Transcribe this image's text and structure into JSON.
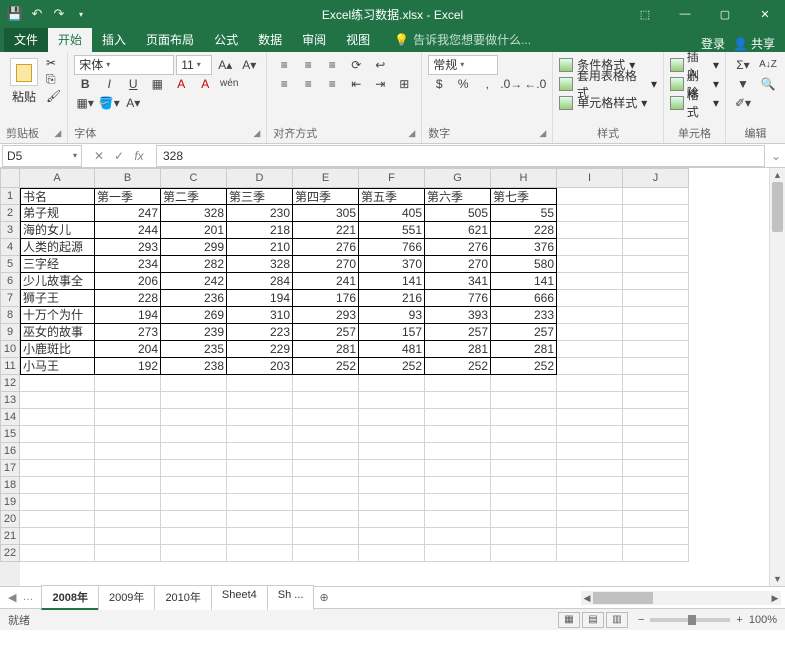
{
  "window": {
    "title": "Excel练习数据.xlsx - Excel"
  },
  "tabs": {
    "file": "文件",
    "home": "开始",
    "insert": "插入",
    "pagelayout": "页面布局",
    "formulas": "公式",
    "data": "数据",
    "review": "审阅",
    "view": "视图",
    "tellme": "告诉我您想要做什么...",
    "login": "登录",
    "share": "共享"
  },
  "ribbon": {
    "clipboard": {
      "paste": "粘贴",
      "label": "剪贴板"
    },
    "font": {
      "name": "宋体",
      "size": "11",
      "label": "字体"
    },
    "align": {
      "label": "对齐方式"
    },
    "number": {
      "format": "常规",
      "label": "数字"
    },
    "styles": {
      "cond": "条件格式",
      "table": "套用表格格式",
      "cell": "单元格样式",
      "label": "样式"
    },
    "cells": {
      "insert": "插入",
      "delete": "删除",
      "format": "格式",
      "label": "单元格"
    },
    "edit": {
      "label": "编辑"
    }
  },
  "namebox": "D5",
  "formula": "328",
  "columns": [
    "A",
    "B",
    "C",
    "D",
    "E",
    "F",
    "G",
    "H",
    "I",
    "J"
  ],
  "headers": [
    "书名",
    "第一季",
    "第二季",
    "第三季",
    "第四季",
    "第五季",
    "第六季",
    "第七季"
  ],
  "data": [
    [
      "弟子规",
      247,
      328,
      230,
      305,
      405,
      505,
      55
    ],
    [
      "海的女儿",
      244,
      201,
      218,
      221,
      551,
      621,
      228
    ],
    [
      "人类的起源",
      293,
      299,
      210,
      276,
      766,
      276,
      376
    ],
    [
      "三字经",
      234,
      282,
      328,
      270,
      370,
      270,
      580
    ],
    [
      "少儿故事全",
      206,
      242,
      284,
      241,
      141,
      341,
      141
    ],
    [
      "狮子王",
      228,
      236,
      194,
      176,
      216,
      776,
      666
    ],
    [
      "十万个为什",
      194,
      269,
      310,
      293,
      93,
      393,
      233
    ],
    [
      "巫女的故事",
      273,
      239,
      223,
      257,
      157,
      257,
      257
    ],
    [
      "小鹿斑比",
      204,
      235,
      229,
      281,
      481,
      281,
      281
    ],
    [
      "小马王",
      192,
      238,
      203,
      252,
      252,
      252,
      252
    ]
  ],
  "chart_data": {
    "type": "table",
    "title": "Excel练习数据",
    "columns": [
      "书名",
      "第一季",
      "第二季",
      "第三季",
      "第四季",
      "第五季",
      "第六季",
      "第七季"
    ],
    "rows": [
      [
        "弟子规",
        247,
        328,
        230,
        305,
        405,
        505,
        55
      ],
      [
        "海的女儿",
        244,
        201,
        218,
        221,
        551,
        621,
        228
      ],
      [
        "人类的起源",
        293,
        299,
        210,
        276,
        766,
        276,
        376
      ],
      [
        "三字经",
        234,
        282,
        328,
        270,
        370,
        270,
        580
      ],
      [
        "少儿故事全",
        206,
        242,
        284,
        241,
        141,
        341,
        141
      ],
      [
        "狮子王",
        228,
        236,
        194,
        176,
        216,
        776,
        666
      ],
      [
        "十万个为什",
        194,
        269,
        310,
        293,
        93,
        393,
        233
      ],
      [
        "巫女的故事",
        273,
        239,
        223,
        257,
        157,
        257,
        257
      ],
      [
        "小鹿斑比",
        204,
        235,
        229,
        281,
        481,
        281,
        281
      ],
      [
        "小马王",
        192,
        238,
        203,
        252,
        252,
        252,
        252
      ]
    ]
  },
  "sheets": [
    "2008年",
    "2009年",
    "2010年",
    "Sheet4",
    "Sh ..."
  ],
  "active_sheet": 0,
  "status": {
    "ready": "就绪",
    "zoom": "100%"
  }
}
